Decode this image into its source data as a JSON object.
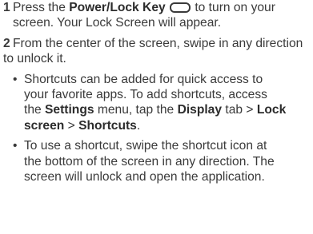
{
  "step1": {
    "number": "1",
    "t1": "Press the ",
    "key": "Power/Lock Key",
    "key_icon": "rounded-rectangle-key-icon",
    "t2": " to turn on your",
    "line2": "screen. Your Lock Screen will appear."
  },
  "step2": {
    "number": "2",
    "line1": "From the center of the screen, swipe in any direction",
    "line2": "to unlock it."
  },
  "bullet1": {
    "marker": "•",
    "line1": "Shortcuts can be added for quick access to",
    "line2": "your favorite apps. To add shortcuts, access",
    "t1": "the ",
    "settings": "Settings",
    "t2": " menu, tap the ",
    "display": "Display",
    "t3": " tab > ",
    "lock": "Lock",
    "screen": "screen",
    "t4": " > ",
    "shortcuts": "Shortcuts",
    "t5": "."
  },
  "bullet2": {
    "marker": "•",
    "line1": "To use a shortcut, swipe the shortcut icon at",
    "line2": "the bottom of the screen in any direction. The",
    "line3": "screen will unlock and open the application."
  }
}
